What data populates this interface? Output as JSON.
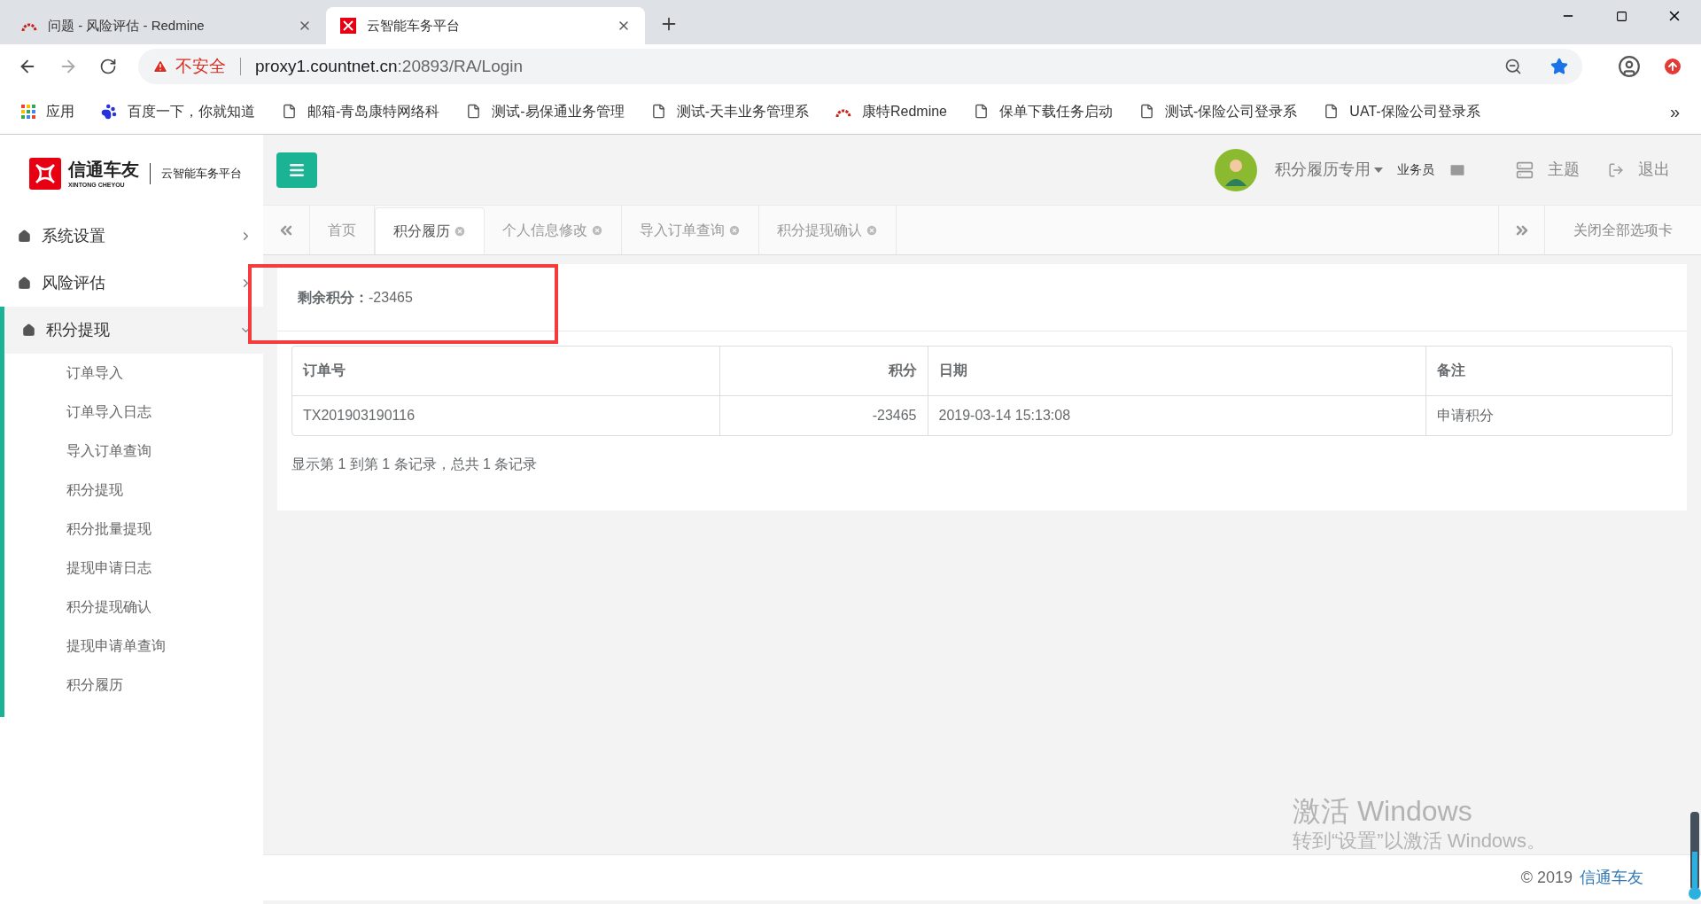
{
  "browser": {
    "tabs": [
      {
        "title": "问题 - 风险评估 - Redmine",
        "kind": "redmine",
        "selected": false
      },
      {
        "title": "云智能车务平台",
        "kind": "app",
        "selected": true
      }
    ],
    "address": {
      "warning": "不安全",
      "host": "proxy1.countnet.cn",
      "path": ":20893/RA/Login"
    },
    "bookmarks": [
      {
        "label": "应用",
        "kind": "apps"
      },
      {
        "label": "百度一下，你就知道",
        "kind": "baidu"
      },
      {
        "label": "邮箱-青岛康特网络科",
        "kind": "page"
      },
      {
        "label": "测试-易保通业务管理",
        "kind": "page"
      },
      {
        "label": "测试-天丰业务管理系",
        "kind": "page"
      },
      {
        "label": "康特Redmine",
        "kind": "redmine"
      },
      {
        "label": "保单下载任务启动",
        "kind": "page"
      },
      {
        "label": "测试-保险公司登录系",
        "kind": "page"
      },
      {
        "label": "UAT-保险公司登录系",
        "kind": "page"
      }
    ],
    "more": "»"
  },
  "logo": {
    "name": "信通车友",
    "latin": "XINTONG CHEYOU",
    "subtitle": "云智能车务平台"
  },
  "sidebar": {
    "items": [
      {
        "label": "系统设置",
        "expanded": false
      },
      {
        "label": "风险评估",
        "expanded": false
      },
      {
        "label": "积分提现",
        "expanded": true,
        "children": [
          {
            "label": "订单导入"
          },
          {
            "label": "订单导入日志"
          },
          {
            "label": "导入订单查询"
          },
          {
            "label": "积分提现"
          },
          {
            "label": "积分批量提现"
          },
          {
            "label": "提现申请日志"
          },
          {
            "label": "积分提现确认"
          },
          {
            "label": "提现申请单查询"
          },
          {
            "label": "积分履历"
          }
        ]
      }
    ]
  },
  "header": {
    "user": "积分履历专用",
    "role": "业务员",
    "theme": "主题",
    "logout": "退出"
  },
  "tabs": [
    {
      "label": "首页",
      "selected": false,
      "closable": false
    },
    {
      "label": "积分履历",
      "selected": true,
      "closable": true
    },
    {
      "label": "个人信息修改",
      "selected": false,
      "closable": true
    },
    {
      "label": "导入订单查询",
      "selected": false,
      "closable": true
    },
    {
      "label": "积分提现确认",
      "selected": false,
      "closable": true
    }
  ],
  "close_all": "关闭全部选项卡",
  "balance": {
    "label": "剩余积分：",
    "value": "-23465"
  },
  "table": {
    "columns": [
      {
        "label": "订单号",
        "kind": "text"
      },
      {
        "label": "积分",
        "kind": "number"
      },
      {
        "label": "日期",
        "kind": "text"
      },
      {
        "label": "备注",
        "kind": "text"
      }
    ],
    "rows": [
      [
        "TX201903190116",
        "-23465",
        "2019-03-14 15:13:08",
        "申请积分"
      ]
    ]
  },
  "pagination": "显示第 1 到第 1 条记录，总共 1 条记录",
  "footer": {
    "copyright": "© 2019",
    "brand": "信通车友"
  },
  "activation": {
    "title": "激活 Windows",
    "hint": "转到“设置”以激活 Windows。"
  }
}
